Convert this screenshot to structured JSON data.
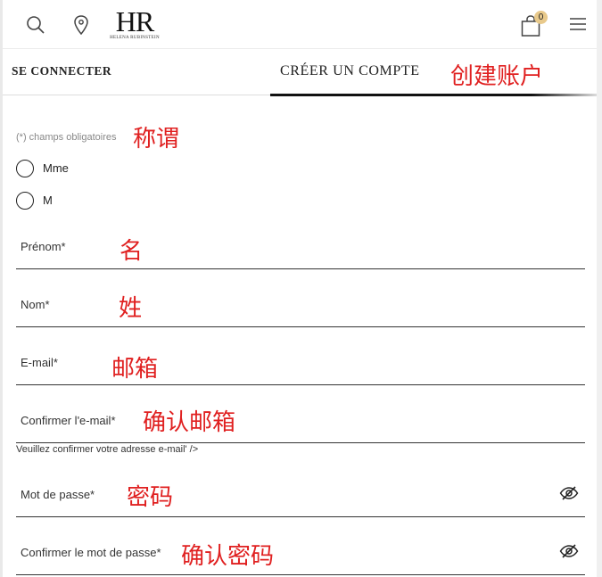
{
  "header": {
    "logo_text": "HR",
    "logo_subtitle": "HELENA RUBINSTEIN",
    "cart_count": "0",
    "icons": [
      "search-icon",
      "location-pin-icon",
      "shopping-bag-icon",
      "menu-icon"
    ]
  },
  "tabs": {
    "login_label": "SE CONNECTER",
    "create_label": "CRÉER UN COMPTE"
  },
  "form": {
    "required_note": "(*) champs obligatoires",
    "title_options": [
      "Mme",
      "M"
    ],
    "fields": {
      "firstname": "Prénom*",
      "lastname": "Nom*",
      "email": "E-mail*",
      "email_confirm": "Confirmer l'e-mail*",
      "email_confirm_hint": "Veuillez confirmer votre adresse e-mail' />",
      "password": "Mot de passe*",
      "password_confirm": "Confirmer le mot de passe*"
    }
  },
  "annotations": {
    "create_account": "创建账户",
    "title": "称谓",
    "firstname": "名",
    "lastname": "姓",
    "email": "邮箱",
    "email_confirm": "确认邮箱",
    "password": "密码",
    "password_confirm": "确认密码"
  },
  "colors": {
    "annotation_red": "#e02020",
    "badge": "#e8c98b",
    "text": "#222222"
  }
}
